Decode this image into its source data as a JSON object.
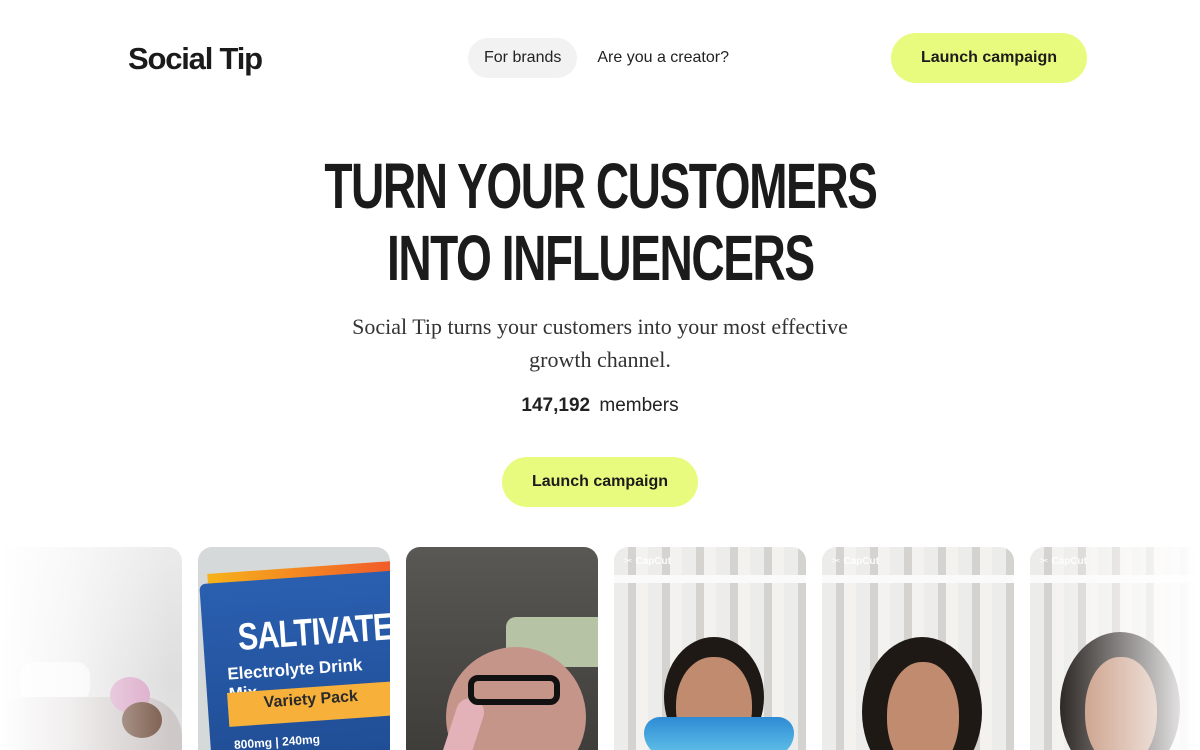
{
  "header": {
    "logo": "Social Tip",
    "nav": [
      {
        "label": "For brands",
        "active": true
      },
      {
        "label": "Are you a creator?",
        "active": false
      }
    ],
    "cta_label": "Launch campaign"
  },
  "hero": {
    "headline_line1": "TURN YOUR CUSTOMERS",
    "headline_line2": "INTO INFLUENCERS",
    "subtitle": "Social Tip turns your customers into your most effective growth channel.",
    "members_count": "147,192",
    "members_label": "members",
    "cta_label": "Launch campaign"
  },
  "cards": {
    "capcut_label": "CapCut",
    "saltivate": {
      "brand": "SALTIVATE",
      "sub": "Electrolyte Drink Mix",
      "variety": "Variety Pack",
      "spec": "800mg | 240mg"
    }
  },
  "colors": {
    "accent": "#e8fb7e",
    "nav_active_bg": "#f2f2f2",
    "text": "#1b1b1b"
  }
}
